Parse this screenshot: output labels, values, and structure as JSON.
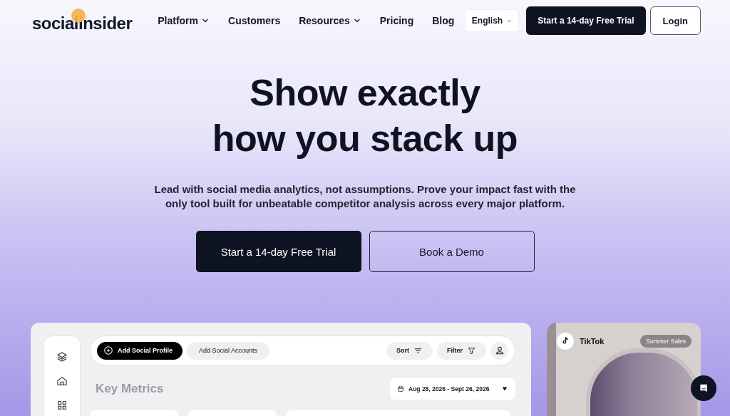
{
  "header": {
    "logo": "socialinsider",
    "nav": [
      {
        "label": "Platform",
        "dropdown": true
      },
      {
        "label": "Customers",
        "dropdown": false
      },
      {
        "label": "Resources",
        "dropdown": true
      },
      {
        "label": "Pricing",
        "dropdown": false
      },
      {
        "label": "Blog",
        "dropdown": false
      }
    ],
    "language": "English",
    "trial_button": "Start a 14-day Free Trial",
    "login_button": "Login"
  },
  "hero": {
    "title_lines": [
      "Show exactly",
      "how you stack up"
    ],
    "subtitle": "Lead with social media analytics, not assumptions. Prove your impact fast with the only tool built for unbeatable competitor analysis across every major platform.",
    "primary_button": "Start a 14-day Free Trial",
    "secondary_button": "Book a Demo"
  },
  "dashboard": {
    "add_profile_button": "Add Social Profile",
    "add_accounts_button": "Add Social Accounts",
    "sort_button": "Sort",
    "filter_button": "Filter",
    "section_title": "Key Metrics",
    "date_range": "Aug 28, 2026 - Sept 26, 2026"
  },
  "post_card": {
    "platform": "TikTok",
    "tag": "Summer Sales"
  }
}
